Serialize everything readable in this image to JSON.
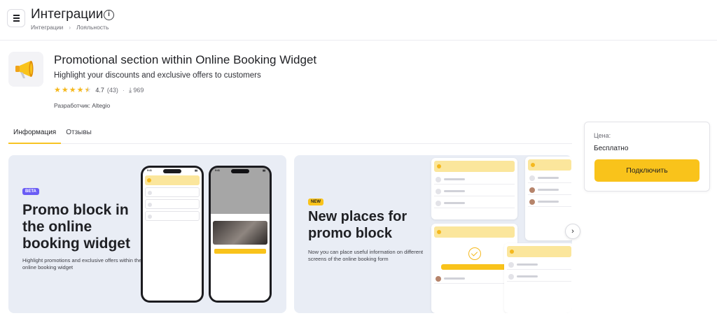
{
  "header": {
    "title": "Интеграции",
    "breadcrumb": [
      "Интеграции",
      "Лояльность"
    ],
    "breadcrumb_sep": "›"
  },
  "app": {
    "name": "Promotional section within Online Booking Widget",
    "description": "Highlight your discounts and exclusive offers to customers",
    "rating": "4.7",
    "rating_stars": 4.7,
    "reviews_count": "(43)",
    "rating_sep": "·",
    "downloads": "969",
    "developer": "Разработчик: Altegio",
    "icon": "megaphone-icon"
  },
  "tabs": [
    {
      "label": "Информация",
      "active": true
    },
    {
      "label": "Отзывы",
      "active": false
    }
  ],
  "pricing": {
    "label": "Цена:",
    "value": "Бесплатно",
    "button": "Подключить"
  },
  "banners": [
    {
      "badge": "BETA",
      "title": "Promo block in the online booking widget",
      "subtitle": "Highlight promotions and exclusive offers within the online booking widget"
    },
    {
      "badge": "NEW",
      "title": "New places for promo block",
      "subtitle": "Now you can place useful information on different screens of the online booking form"
    }
  ],
  "colors": {
    "accent": "#f9c31b",
    "beta_badge": "#6a5cf5",
    "banner_bg": "#e9edf5"
  }
}
